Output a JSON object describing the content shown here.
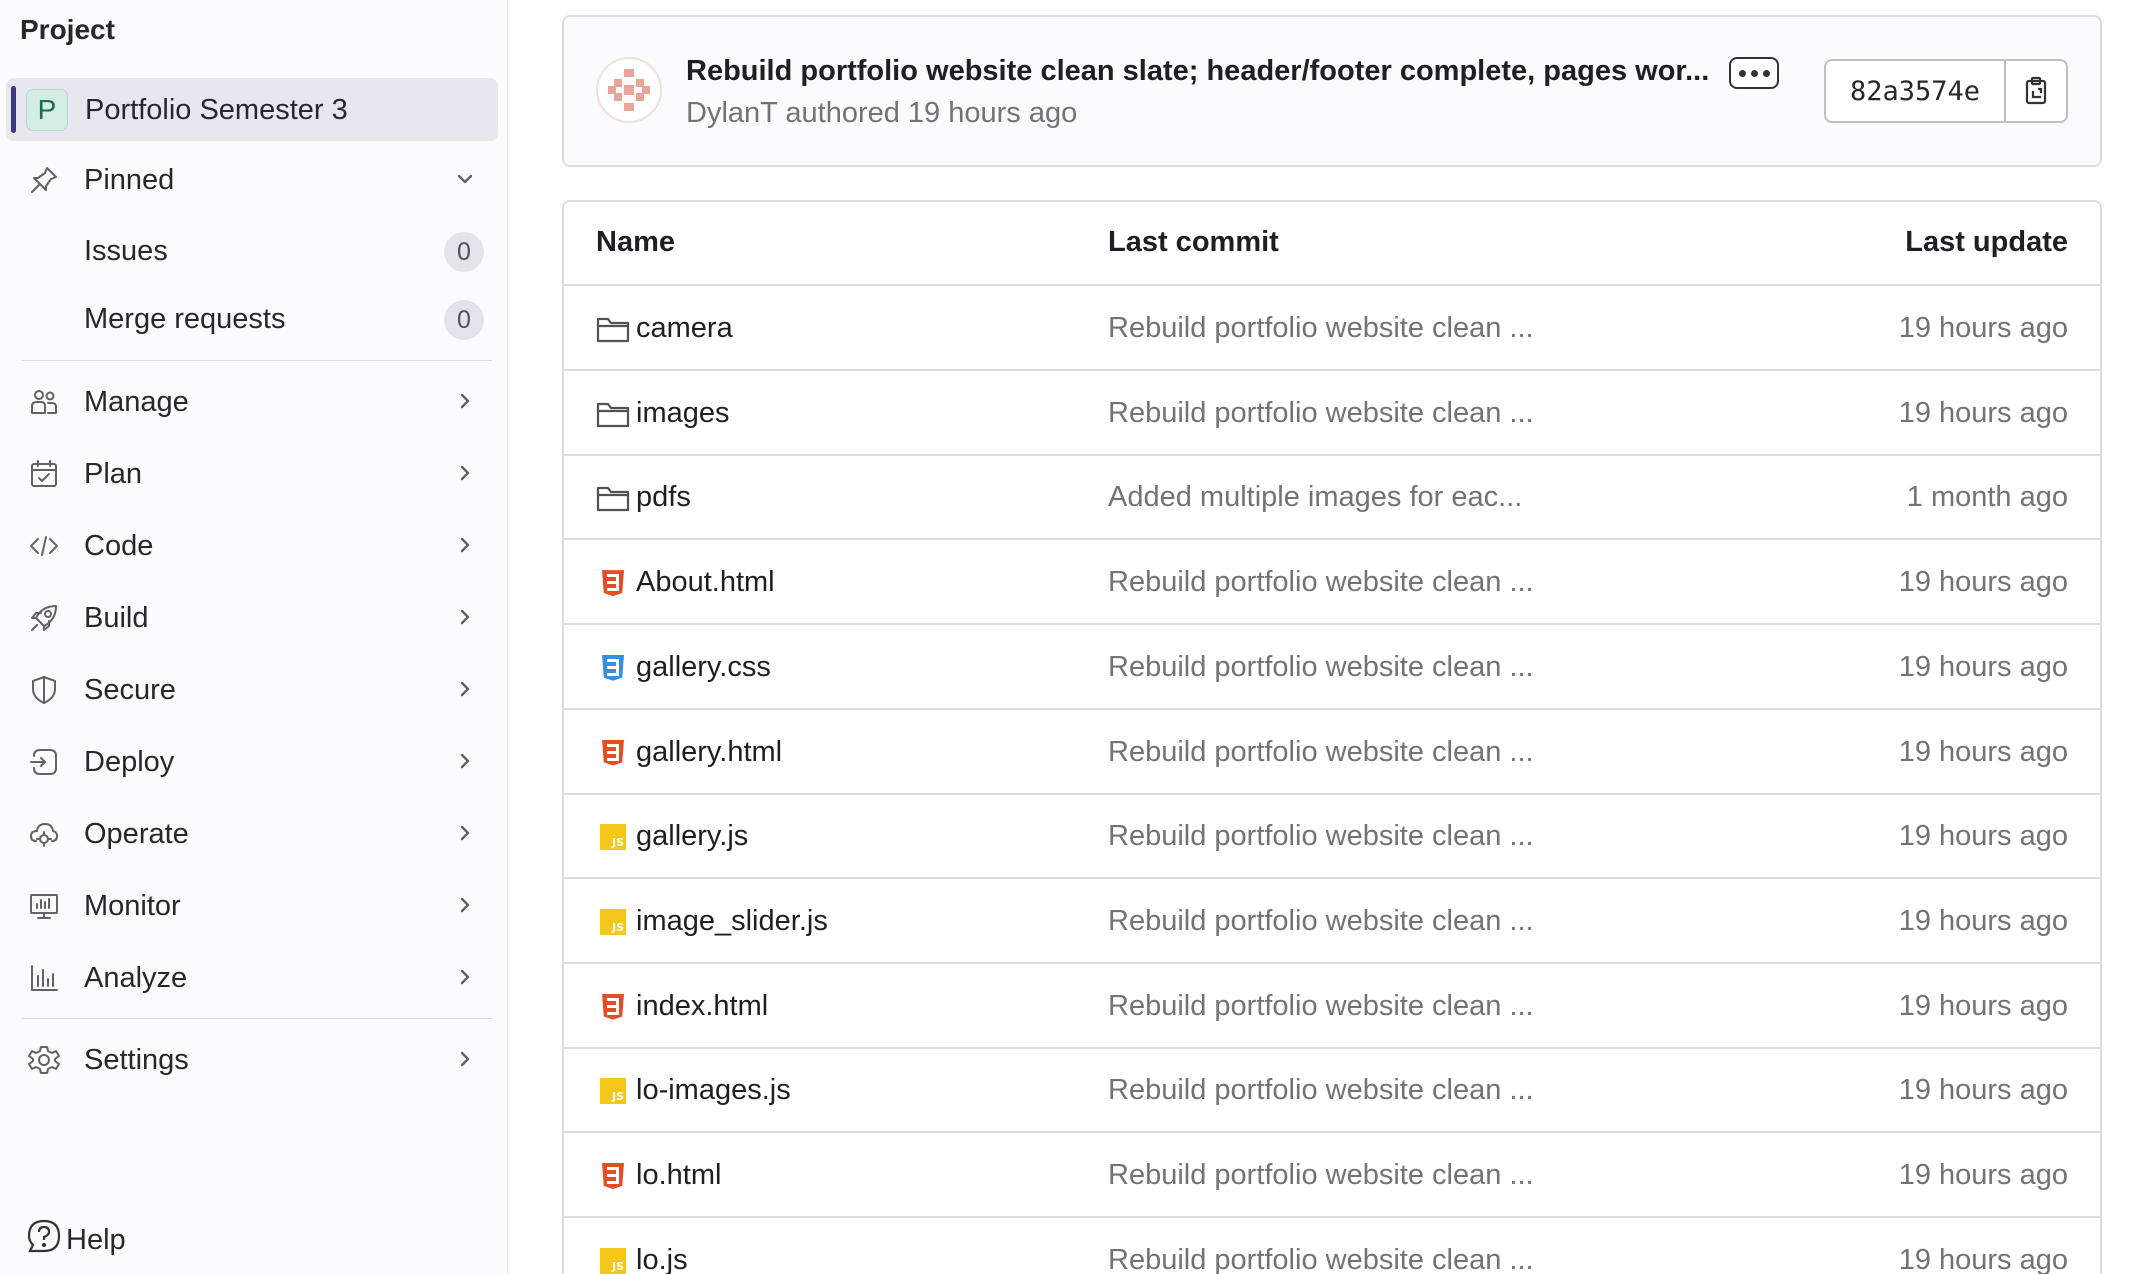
{
  "sidebar": {
    "section_title": "Project",
    "project": {
      "avatar_letter": "P",
      "name": "Portfolio Semester 3"
    },
    "pinned": {
      "label": "Pinned",
      "items": [
        {
          "label": "Issues",
          "count": "0"
        },
        {
          "label": "Merge requests",
          "count": "0"
        }
      ]
    },
    "nav": [
      {
        "label": "Manage",
        "icon": "users-icon"
      },
      {
        "label": "Plan",
        "icon": "calendar-icon"
      },
      {
        "label": "Code",
        "icon": "code-icon"
      },
      {
        "label": "Build",
        "icon": "rocket-icon"
      },
      {
        "label": "Secure",
        "icon": "shield-icon"
      },
      {
        "label": "Deploy",
        "icon": "deploy-icon"
      },
      {
        "label": "Operate",
        "icon": "cloud-gear-icon"
      },
      {
        "label": "Monitor",
        "icon": "monitor-icon"
      },
      {
        "label": "Analyze",
        "icon": "chart-icon"
      }
    ],
    "settings": {
      "label": "Settings",
      "icon": "gear-icon"
    },
    "help": {
      "label": "Help",
      "icon": "help-icon"
    }
  },
  "commit": {
    "title": "Rebuild portfolio website clean slate; header/footer complete, pages wor...",
    "author": "DylanT",
    "meta": "DylanT authored 19 hours ago",
    "sha": "82a3574e"
  },
  "table": {
    "headers": {
      "name": "Name",
      "last_commit": "Last commit",
      "last_update": "Last update"
    },
    "rows": [
      {
        "name": "camera",
        "type": "folder",
        "commit": "Rebuild portfolio website clean ...",
        "updated": "19 hours ago"
      },
      {
        "name": "images",
        "type": "folder",
        "commit": "Rebuild portfolio website clean ...",
        "updated": "19 hours ago"
      },
      {
        "name": "pdfs",
        "type": "folder",
        "commit": "Added multiple images for eac...",
        "updated": "1 month ago"
      },
      {
        "name": "About.html",
        "type": "html",
        "commit": "Rebuild portfolio website clean ...",
        "updated": "19 hours ago"
      },
      {
        "name": "gallery.css",
        "type": "css",
        "commit": "Rebuild portfolio website clean ...",
        "updated": "19 hours ago"
      },
      {
        "name": "gallery.html",
        "type": "html",
        "commit": "Rebuild portfolio website clean ...",
        "updated": "19 hours ago"
      },
      {
        "name": "gallery.js",
        "type": "js",
        "commit": "Rebuild portfolio website clean ...",
        "updated": "19 hours ago"
      },
      {
        "name": "image_slider.js",
        "type": "js",
        "commit": "Rebuild portfolio website clean ...",
        "updated": "19 hours ago"
      },
      {
        "name": "index.html",
        "type": "html",
        "commit": "Rebuild portfolio website clean ...",
        "updated": "19 hours ago"
      },
      {
        "name": "lo-images.js",
        "type": "js",
        "commit": "Rebuild portfolio website clean ...",
        "updated": "19 hours ago"
      },
      {
        "name": "lo.html",
        "type": "html",
        "commit": "Rebuild portfolio website clean ...",
        "updated": "19 hours ago"
      },
      {
        "name": "lo.js",
        "type": "js",
        "commit": "Rebuild portfolio website clean ...",
        "updated": "19 hours ago"
      }
    ]
  },
  "colors": {
    "sidebar_bg": "#fbfafd",
    "active_accent": "#3a3983",
    "html_icon": "#e44d26",
    "css_icon": "#3c8fd7",
    "js_icon": "#f5c71a"
  }
}
